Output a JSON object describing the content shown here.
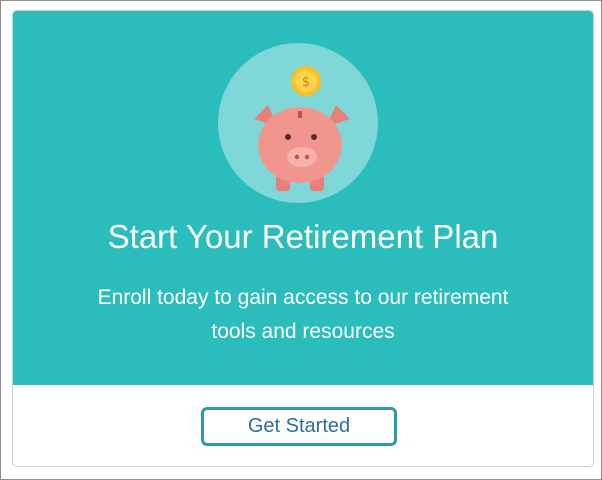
{
  "card": {
    "icon": "piggy-bank-coin-icon",
    "title": "Start Your Retirement Plan",
    "subtitle": "Enroll today to gain access to our retirement tools and resources",
    "button_label": "Get Started"
  },
  "colors": {
    "hero_background": "#2bbdbb",
    "icon_circle": "#7fd7d8",
    "pig_body": "#f0968f",
    "coin": "#f7c126",
    "button_border": "#2c9aa6",
    "button_text": "#2a6f9e"
  }
}
